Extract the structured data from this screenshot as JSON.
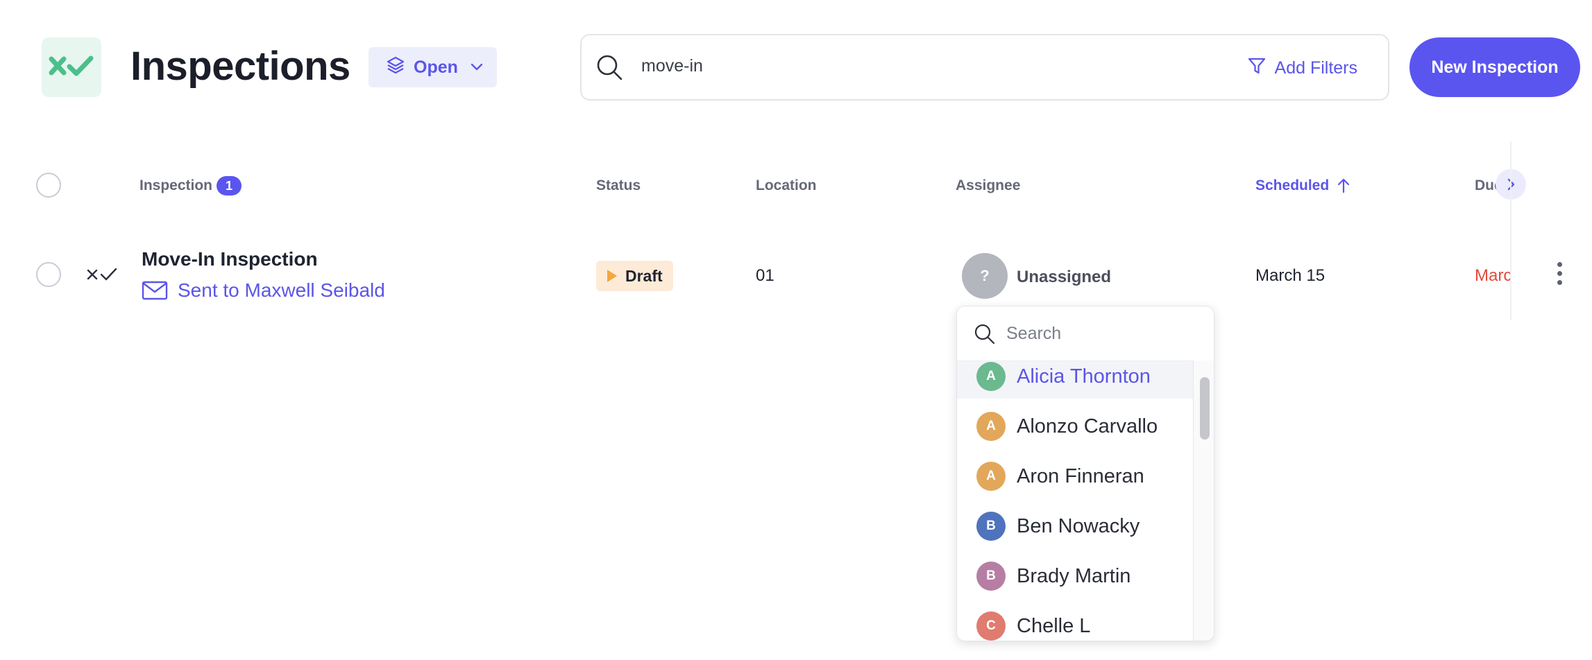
{
  "header": {
    "title": "Inspections",
    "view_filter": "Open",
    "search_value": "move-in",
    "add_filters_label": "Add Filters",
    "new_button_label": "New Inspection"
  },
  "table": {
    "columns": {
      "inspection": "Inspection",
      "inspection_count": "1",
      "status": "Status",
      "location": "Location",
      "assignee": "Assignee",
      "scheduled": "Scheduled",
      "due": "Due"
    },
    "sort": {
      "column": "Scheduled",
      "direction": "ascending"
    },
    "rows": [
      {
        "title": "Move-In Inspection",
        "sent_to": "Sent to Maxwell Seibald",
        "status": "Draft",
        "location": "01",
        "assignee_initial": "?",
        "assignee": "Unassigned",
        "scheduled": "March 15",
        "due": "March"
      }
    ]
  },
  "assignee_dropdown": {
    "search_placeholder": "Search",
    "items": [
      {
        "initial": "A",
        "name": "Alicia Thornton",
        "color": "#6bb98f",
        "highlighted": true
      },
      {
        "initial": "A",
        "name": "Alonzo Carvallo",
        "color": "#e2a75a",
        "highlighted": false
      },
      {
        "initial": "A",
        "name": "Aron Finneran",
        "color": "#e2a75a",
        "highlighted": false
      },
      {
        "initial": "B",
        "name": "Ben Nowacky",
        "color": "#4f73bd",
        "highlighted": false
      },
      {
        "initial": "B",
        "name": "Brady Martin",
        "color": "#b77ea3",
        "highlighted": false
      },
      {
        "initial": "C",
        "name": "Chelle L",
        "color": "#e07b6f",
        "highlighted": false
      }
    ]
  },
  "colors": {
    "accent": "#5b55f0",
    "draft_badge_bg": "#fdebd8",
    "draft_marker": "#f4a640",
    "due_text": "#e24a3b",
    "logo_green": "#4cbf8c"
  }
}
